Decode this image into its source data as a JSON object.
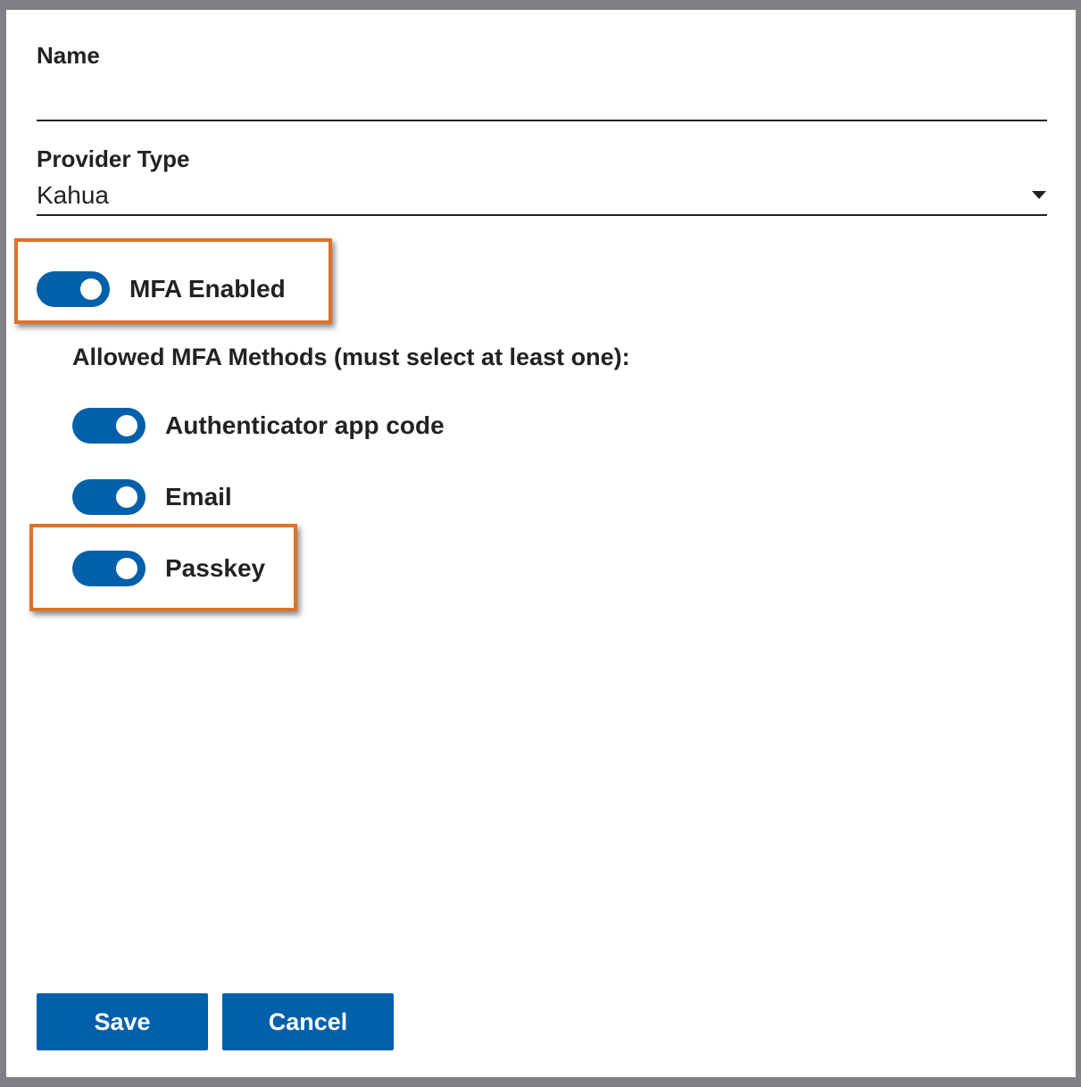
{
  "form": {
    "name": {
      "label": "Name",
      "value": "",
      "placeholder": ""
    },
    "provider_type": {
      "label": "Provider Type",
      "selected": "Kahua",
      "icon": "chevron-down-icon"
    },
    "mfa_enabled": {
      "label": "MFA Enabled",
      "on": true
    },
    "mfa_methods": {
      "heading": "Allowed MFA Methods (must select at least one):",
      "items": [
        {
          "label": "Authenticator app code",
          "on": true
        },
        {
          "label": "Email",
          "on": true
        },
        {
          "label": "Passkey",
          "on": true
        }
      ]
    }
  },
  "actions": {
    "save_label": "Save",
    "cancel_label": "Cancel"
  },
  "colors": {
    "accent": "#0060aa",
    "highlight": "#e07126",
    "text": "#222222",
    "backdrop": "#7f8083"
  }
}
